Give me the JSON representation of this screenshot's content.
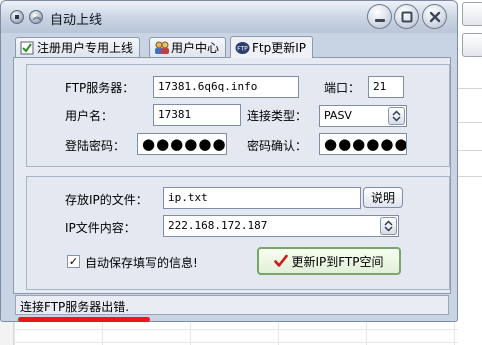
{
  "window": {
    "title": "自动上线",
    "controls": [
      "minimize-icon",
      "maximize-icon",
      "close-icon"
    ]
  },
  "tabs": [
    {
      "label": "注册用户专用上线",
      "icon": "checklist-icon",
      "active": false
    },
    {
      "label": "用户中心",
      "icon": "users-icon",
      "active": false
    },
    {
      "label": "Ftp更新IP",
      "icon": "ftp-icon",
      "active": true
    }
  ],
  "ftp": {
    "server_label": "FTP服务器：",
    "server_value": "17381.6q6q.info",
    "port_label": "端口：",
    "port_value": "21",
    "username_label": "用户名：",
    "username_value": "17381",
    "conn_type_label": "连接类型：",
    "conn_type_value": "PASV",
    "password_label": "登陆密码：",
    "password_value": "●●●●●●",
    "confirm_label": "密码确认：",
    "confirm_value": "●●●●●●"
  },
  "ipfile": {
    "file_label": "存放IP的文件：",
    "file_value": "ip.txt",
    "help_button": "说明",
    "content_label": "IP文件内容：",
    "content_value": "222.168.172.187",
    "autosave_label": "自动保存填写的信息!",
    "autosave_checked": true,
    "update_button": "更新IP到FTP空间"
  },
  "status": {
    "text": "连接FTP服务器出错."
  },
  "colors": {
    "accent_red": "#e8191c",
    "update_check": "#d01818"
  }
}
